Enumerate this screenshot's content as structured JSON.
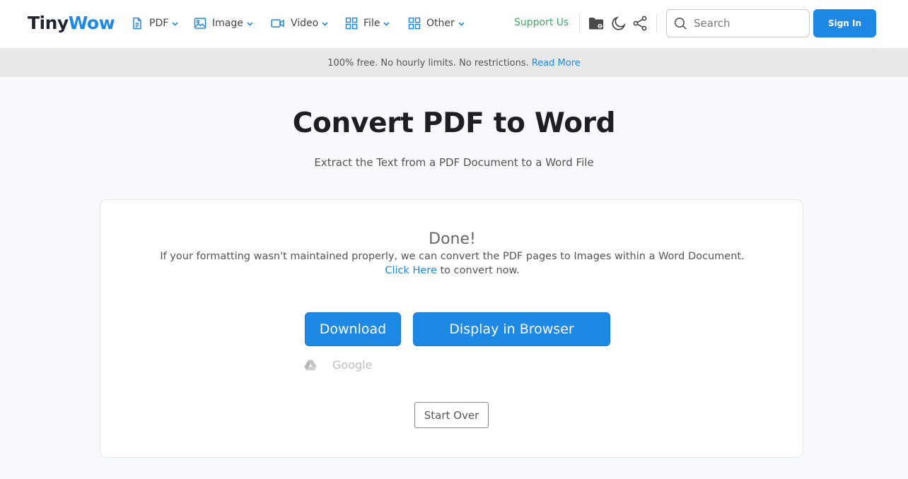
{
  "header": {
    "logo_part1": "Tiny",
    "logo_part2": "Wow",
    "nav": [
      {
        "label": "PDF",
        "icon": "pdf-file-icon"
      },
      {
        "label": "Image",
        "icon": "image-icon"
      },
      {
        "label": "Video",
        "icon": "video-icon"
      },
      {
        "label": "File",
        "icon": "grid-icon"
      },
      {
        "label": "Other",
        "icon": "grid-icon"
      }
    ],
    "support_label": "Support Us",
    "search_placeholder": "Search",
    "signin_label": "Sign In"
  },
  "banner": {
    "text": "100% free. No hourly limits. No restrictions.",
    "link": "Read More"
  },
  "main": {
    "title": "Convert PDF to Word",
    "subtitle": "Extract the Text from a PDF Document to a Word File"
  },
  "result": {
    "done": "Done!",
    "note": "If your formatting wasn't maintained properly, we can convert the PDF pages to Images within a Word Document.",
    "click_link": "Click Here",
    "click_suffix": " to convert now.",
    "download_label": "Download",
    "display_label": "Display in Browser",
    "google_label": "Google",
    "start_over_label": "Start Over"
  },
  "colors": {
    "accent": "#1e88e5",
    "support": "#43a66b",
    "banner_bg": "#e8e8e8"
  }
}
